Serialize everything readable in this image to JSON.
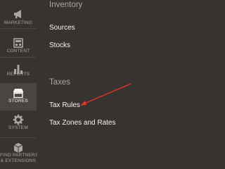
{
  "sidebar": {
    "items": [
      {
        "label": "MARKETING",
        "icon": "megaphone-icon"
      },
      {
        "label": "CONTENT",
        "icon": "content-layout-icon"
      },
      {
        "label": "REPORTS",
        "icon": "bar-chart-icon"
      },
      {
        "label": "STORES",
        "icon": "store-front-icon",
        "active": true
      },
      {
        "label": "SYSTEM",
        "icon": "gear-icon"
      },
      {
        "label": "FIND PARTNERS",
        "label_line2": "& EXTENSIONS",
        "icon": "extensions-box-icon"
      }
    ]
  },
  "panel": {
    "inventory": {
      "title": "Inventory",
      "links": [
        "Sources",
        "Stocks"
      ]
    },
    "taxes": {
      "title": "Taxes",
      "links": [
        "Tax Rules",
        "Tax Zones and Rates"
      ]
    }
  },
  "annotation": {
    "arrow_color": "#e0352b",
    "points_to": "Tax Rules"
  },
  "colors": {
    "background": "#373330",
    "active_item": "#4a4542",
    "link_text": "#f7f3eb",
    "muted_text": "#aaa6a0"
  }
}
